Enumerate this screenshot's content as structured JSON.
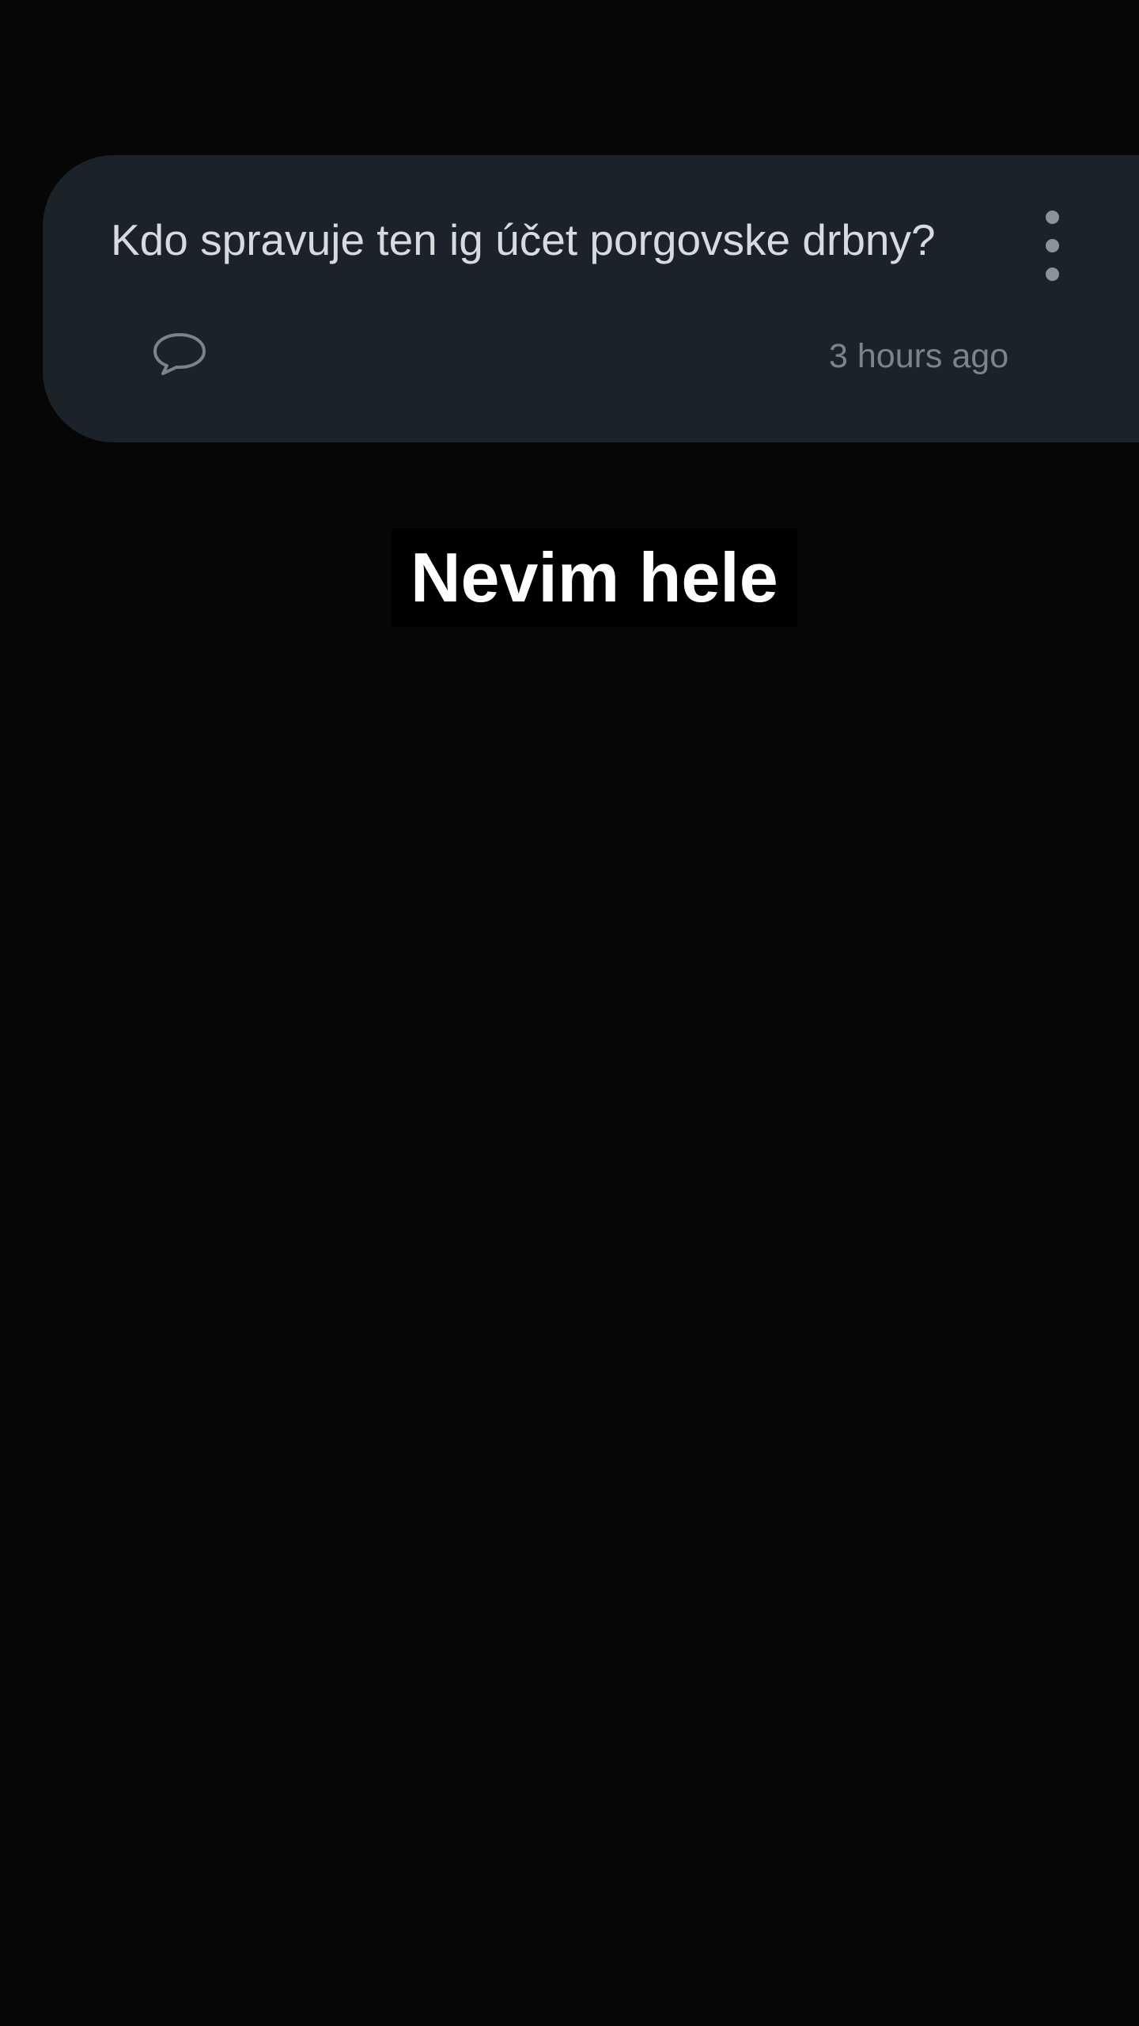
{
  "post": {
    "question": "Kdo spravuje ten ig účet porgovske drbny?",
    "timestamp": "3 hours ago",
    "menu_icon": "more-vertical-icon",
    "comment_icon": "comment-bubble-icon"
  },
  "overlay": {
    "caption": "Nevim hele"
  },
  "colors": {
    "background": "#070607",
    "card": "#1c222a",
    "question_text": "#d8dade",
    "muted_text": "#7e838a",
    "caption_text": "#ffffff",
    "caption_background": "#000000"
  }
}
